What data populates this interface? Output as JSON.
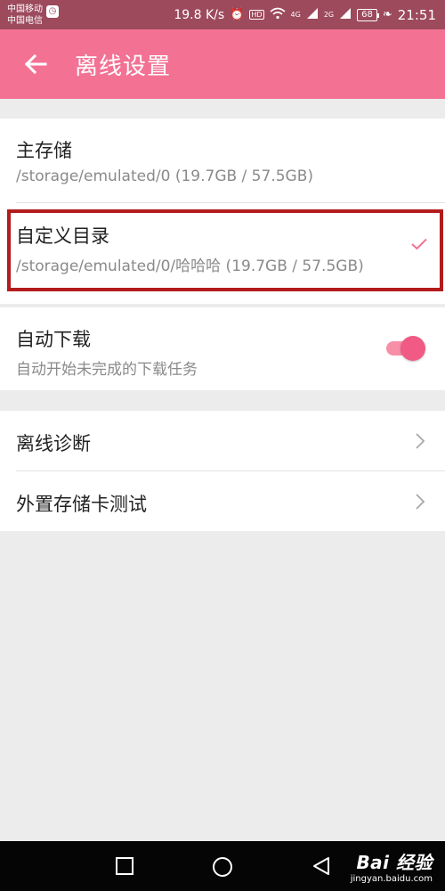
{
  "status_bar": {
    "carrier1": "中国移动",
    "carrier2": "中国电信",
    "network_speed": "19.8 K/s",
    "hd_label": "HD",
    "network_4g": "4G",
    "network_2g": "2G",
    "battery_level": "68",
    "time": "21:51"
  },
  "app_bar": {
    "title": "离线设置"
  },
  "storage": {
    "primary": {
      "title": "主存储",
      "path": "/storage/emulated/0 (19.7GB / 57.5GB)"
    },
    "custom": {
      "title": "自定义目录",
      "path": "/storage/emulated/0/哈哈哈 (19.7GB / 57.5GB)",
      "selected": true
    }
  },
  "auto_download": {
    "title": "自动下载",
    "subtitle": "自动开始未完成的下载任务",
    "enabled": true
  },
  "more": {
    "items": [
      {
        "label": "离线诊断"
      },
      {
        "label": "外置存储卡测试"
      }
    ]
  },
  "watermark": {
    "main": "Bai 经验",
    "sub": "jingyan.baidu.com"
  },
  "colors": {
    "accent": "#f37294",
    "status_bar": "#9c4a5c",
    "highlight_border": "#b31c1c",
    "toggle_on": "#f05a84"
  }
}
